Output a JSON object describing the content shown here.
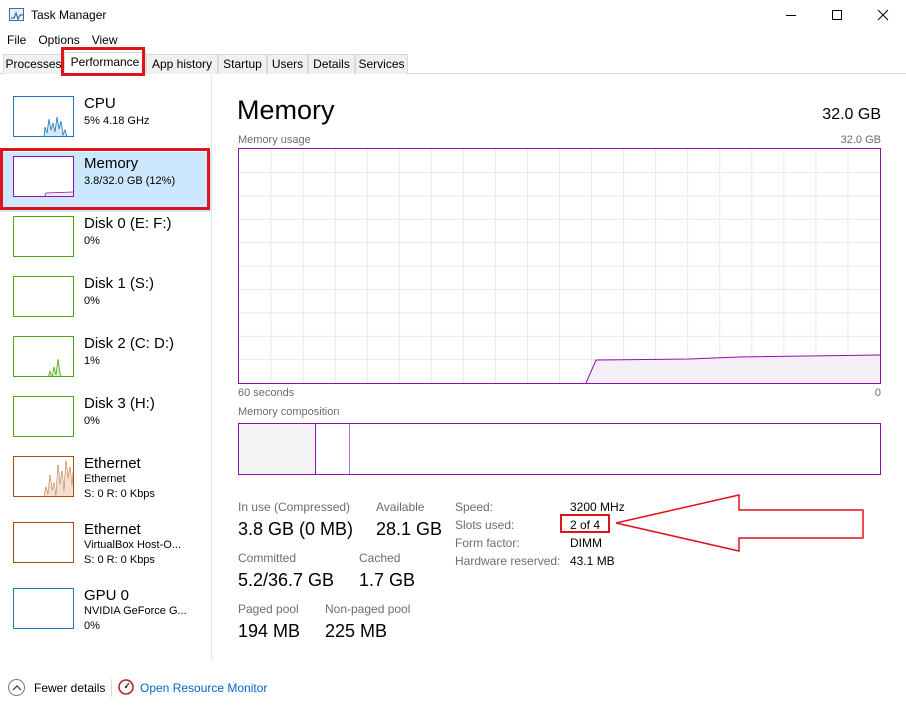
{
  "window": {
    "title": "Task Manager"
  },
  "menu": [
    "File",
    "Options",
    "View"
  ],
  "tabs": [
    "Processes",
    "Performance",
    "App history",
    "Startup",
    "Users",
    "Details",
    "Services"
  ],
  "sidebar": [
    {
      "name": "CPU",
      "detail": "5%  4.18 GHz"
    },
    {
      "name": "Memory",
      "detail": "3.8/32.0 GB (12%)"
    },
    {
      "name": "Disk 0 (E: F:)",
      "detail": "0%"
    },
    {
      "name": "Disk 1 (S:)",
      "detail": "0%"
    },
    {
      "name": "Disk 2 (C: D:)",
      "detail": "1%"
    },
    {
      "name": "Disk 3 (H:)",
      "detail": "0%"
    },
    {
      "name": "Ethernet",
      "detail": "Ethernet",
      "detail2": "S: 0 R: 0 Kbps"
    },
    {
      "name": "Ethernet",
      "detail": "VirtualBox Host-O...",
      "detail2": "S: 0 R: 0 Kbps"
    },
    {
      "name": "GPU 0",
      "detail": "NVIDIA GeForce G...",
      "detail2": "0%"
    }
  ],
  "main": {
    "title": "Memory",
    "total": "32.0 GB",
    "usage_label": "Memory usage",
    "usage_max": "32.0 GB",
    "time_left": "60 seconds",
    "time_right": "0",
    "composition_label": "Memory composition",
    "stats": {
      "in_use_label": "In use (Compressed)",
      "in_use_value": "3.8 GB (0 MB)",
      "available_label": "Available",
      "available_value": "28.1 GB",
      "committed_label": "Committed",
      "committed_value": "5.2/36.7 GB",
      "cached_label": "Cached",
      "cached_value": "1.7 GB",
      "paged_label": "Paged pool",
      "paged_value": "194 MB",
      "nonpaged_label": "Non-paged pool",
      "nonpaged_value": "225 MB"
    },
    "details": {
      "speed_label": "Speed:",
      "speed_value": "3200 MHz",
      "slots_label": "Slots used:",
      "slots_value": "2 of 4",
      "form_label": "Form factor:",
      "form_value": "DIMM",
      "reserved_label": "Hardware reserved:",
      "reserved_value": "43.1 MB"
    }
  },
  "footer": {
    "fewer": "Fewer details",
    "monitor": "Open Resource Monitor"
  },
  "colors": {
    "memory": "#8b12ae",
    "cpu": "#1779ba",
    "disk": "#4da60c",
    "ethernet": "#a74f01",
    "gpu": "#1779ba",
    "highlight": "#e0131a"
  }
}
